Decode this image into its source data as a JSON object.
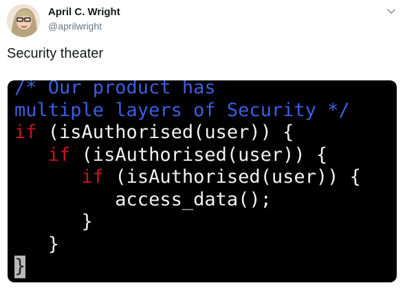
{
  "author": {
    "name": "April C. Wright",
    "handle": "@aprilwright"
  },
  "tweet": {
    "text": "Security theater"
  },
  "code_image": {
    "lines": [
      [
        {
          "t": "/* Our product has",
          "c": "cm"
        }
      ],
      [
        {
          "t": "multiple layers of Security */",
          "c": "cm"
        }
      ],
      [
        {
          "t": "if",
          "c": "kw"
        },
        {
          "t": " (isAuthorised(user)) {",
          "c": "tx"
        }
      ],
      [
        {
          "t": "   ",
          "c": "tx"
        },
        {
          "t": "if",
          "c": "kw"
        },
        {
          "t": " (isAuthorised(user)) {",
          "c": "tx"
        }
      ],
      [
        {
          "t": "      ",
          "c": "tx"
        },
        {
          "t": "if",
          "c": "kw"
        },
        {
          "t": " (isAuthorised(user)) {",
          "c": "tx"
        }
      ],
      [
        {
          "t": "         access_data();",
          "c": "tx"
        }
      ],
      [
        {
          "t": "      }",
          "c": "tx"
        }
      ],
      [
        {
          "t": "   }",
          "c": "tx"
        }
      ],
      [
        {
          "t": "}",
          "c": "cursor"
        }
      ]
    ],
    "colors": {
      "comment": "#3c5fe0",
      "keyword": "#c8141e",
      "text": "#f2f2f2",
      "background": "#000000"
    }
  },
  "icons": {
    "avatar": "avatar-photo",
    "menu": "chevron-down-icon"
  }
}
